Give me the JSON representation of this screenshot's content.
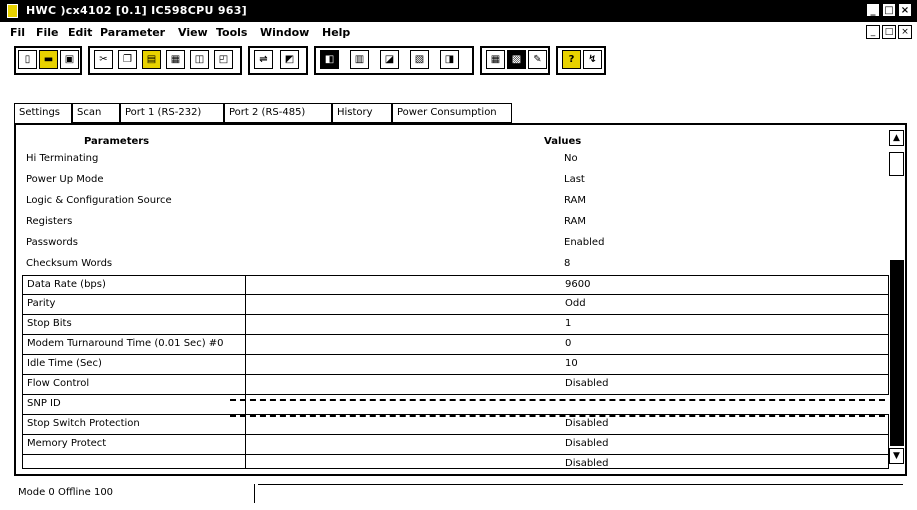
{
  "window": {
    "title": "HWC  )cx4102 [0.1] IC598CPU 963]",
    "controls": [
      "_",
      "□",
      "×"
    ]
  },
  "menu": {
    "items": [
      "Fil",
      "File",
      "Edit",
      "Parameter",
      "View",
      "Tools",
      "Window",
      "Help"
    ],
    "mdi_controls": [
      "_",
      "□",
      "×"
    ]
  },
  "toolbar": {
    "icons": [
      "new-icon",
      "open-icon",
      "save-icon",
      "cut-icon",
      "copy-icon",
      "paste-icon",
      "print-icon",
      "preview-icon",
      "connect-icon",
      "disconnect-icon",
      "read-icon",
      "write-icon",
      "compare-icon",
      "verify-icon",
      "monitor-icon",
      "chart-icon",
      "tools-icon",
      "help-icon",
      "about-icon"
    ]
  },
  "tabs": [
    "Settings",
    "Scan",
    "Port 1 (RS-232)",
    "Port 2 (RS-485)",
    "History",
    "Power Consumption"
  ],
  "grid": {
    "header_parameters": "Parameters",
    "header_values": "Values",
    "rows": [
      {
        "param": "Hi Terminating",
        "value": "No"
      },
      {
        "param": "Power Up Mode",
        "value": "Last"
      },
      {
        "param": "Logic & Configuration Source",
        "value": "RAM"
      },
      {
        "param": "Registers",
        "value": "RAM"
      },
      {
        "param": "Passwords",
        "value": "Enabled"
      },
      {
        "param": "Checksum Words",
        "value": "8"
      },
      {
        "param": "Data Rate (bps)",
        "value": "9600"
      },
      {
        "param": "Parity",
        "value": "Odd"
      },
      {
        "param": "Stop Bits",
        "value": "1"
      },
      {
        "param": "Modem Turnaround Time (0.01 Sec) #0",
        "value": "0"
      },
      {
        "param": "Idle Time (Sec)",
        "value": "10"
      },
      {
        "param": "Flow Control",
        "value": "Disabled"
      },
      {
        "param": "SNP ID",
        "value": ""
      },
      {
        "param": "Stop Switch Protection",
        "value": "Disabled"
      },
      {
        "param": "Memory Protect",
        "value": "Disabled"
      },
      {
        "param": "",
        "value": "Disabled"
      }
    ]
  },
  "scrollbar": {
    "up": "▲",
    "down": "▼"
  },
  "status": {
    "text": "Mode   0   Offline  100"
  }
}
